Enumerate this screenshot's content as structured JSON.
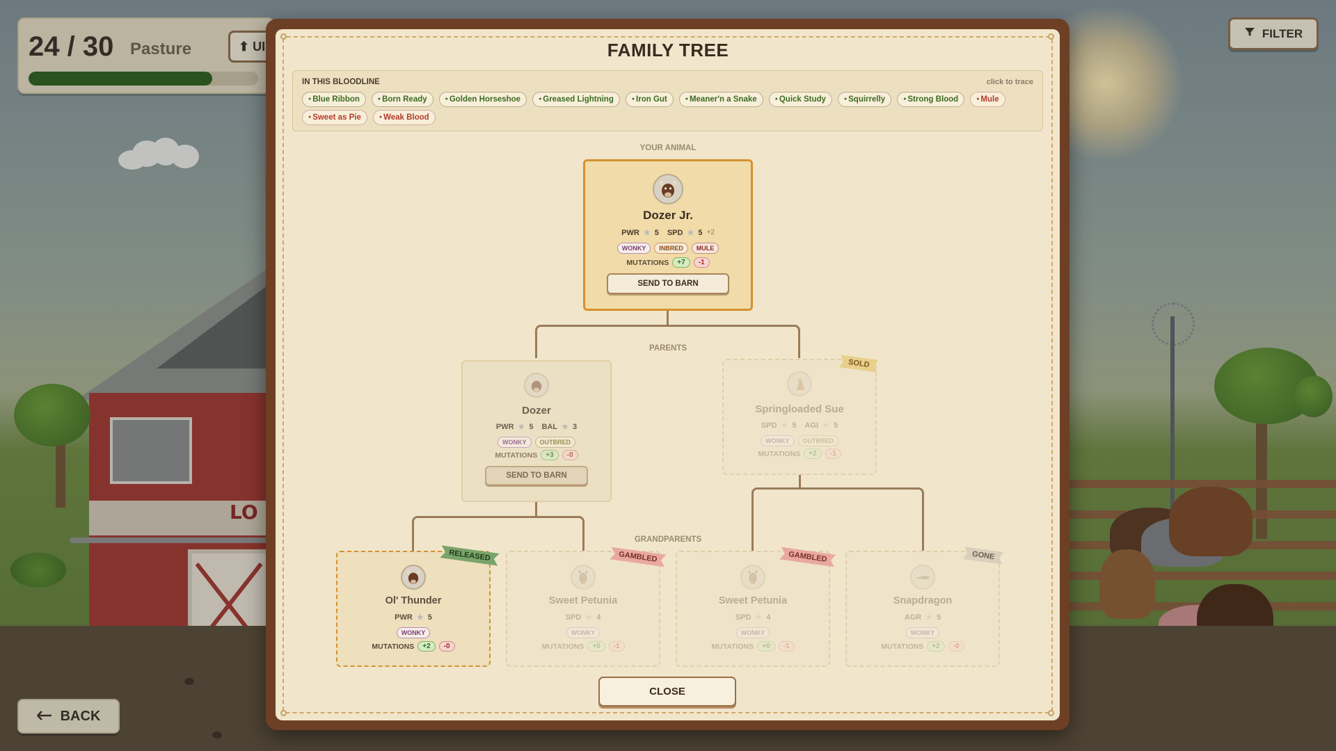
{
  "hud": {
    "count": "24 / 30",
    "label": "Pasture",
    "upgrade_label": "UI",
    "capacity_fraction": 0.8
  },
  "filter_label": "FILTER",
  "back_label": "BACK",
  "barn_sign": "LO",
  "modal": {
    "title": "FAMILY TREE",
    "bloodline_title": "IN THIS BLOODLINE",
    "bloodline_hint": "click to trace",
    "traits": [
      {
        "label": "Blue Ribbon",
        "kind": "good"
      },
      {
        "label": "Born Ready",
        "kind": "good"
      },
      {
        "label": "Golden Horseshoe",
        "kind": "good"
      },
      {
        "label": "Greased Lightning",
        "kind": "good"
      },
      {
        "label": "Iron Gut",
        "kind": "good"
      },
      {
        "label": "Meaner'n a Snake",
        "kind": "good"
      },
      {
        "label": "Quick Study",
        "kind": "good"
      },
      {
        "label": "Squirrelly",
        "kind": "good"
      },
      {
        "label": "Strong Blood",
        "kind": "good"
      },
      {
        "label": "Mule",
        "kind": "bad"
      },
      {
        "label": "Sweet as Pie",
        "kind": "bad"
      },
      {
        "label": "Weak Blood",
        "kind": "bad"
      }
    ],
    "your_animal_label": "YOUR ANIMAL",
    "parents_label": "PARENTS",
    "grandparents_label": "GRANDPARENTS",
    "mutations_label": "MUTATIONS",
    "send_to_barn": "SEND TO BARN",
    "close_label": "CLOSE",
    "animal": {
      "name": "Dozer Jr.",
      "stat1": "PWR",
      "val1": "5",
      "stat2": "SPD",
      "val2": "5",
      "extra": "+2",
      "badges": [
        "WONKY",
        "INBRED",
        "MULE"
      ],
      "mut_plus": "+7",
      "mut_minus": "-1",
      "icon": "bull-icon"
    },
    "parents": [
      {
        "name": "Dozer",
        "stat1": "PWR",
        "val1": "5",
        "stat2": "BAL",
        "val2": "3",
        "badges": [
          "WONKY",
          "OUTBRED"
        ],
        "mut_plus": "+3",
        "mut_minus": "-0",
        "icon": "bull-icon"
      },
      {
        "name": "Springloaded Sue",
        "status": "SOLD",
        "stat1": "SPD",
        "val1": "5",
        "stat2": "AGI",
        "val2": "5",
        "badges": [
          "WONKY",
          "OUTBRED"
        ],
        "mut_plus": "+2",
        "mut_minus": "-1",
        "icon": "kangaroo-icon"
      }
    ],
    "grandparents": [
      {
        "name": "Ol' Thunder",
        "status": "RELEASED",
        "stat": "PWR",
        "val": "5",
        "badge": "WONKY",
        "mut_plus": "+2",
        "mut_minus": "-0",
        "icon": "bull-icon"
      },
      {
        "name": "Sweet Petunia",
        "status": "GAMBLED",
        "stat": "SPD",
        "val": "4",
        "badge": "WONKY",
        "mut_plus": "+0",
        "mut_minus": "-1",
        "icon": "goat-icon"
      },
      {
        "name": "Sweet Petunia",
        "status": "GAMBLED",
        "stat": "SPD",
        "val": "4",
        "badge": "WONKY",
        "mut_plus": "+0",
        "mut_minus": "-1",
        "icon": "goat-icon"
      },
      {
        "name": "Snapdragon",
        "status": "GONE",
        "stat": "AGR",
        "val": "5",
        "badge": "WONKY",
        "mut_plus": "+2",
        "mut_minus": "-0",
        "icon": "alligator-icon"
      }
    ]
  }
}
